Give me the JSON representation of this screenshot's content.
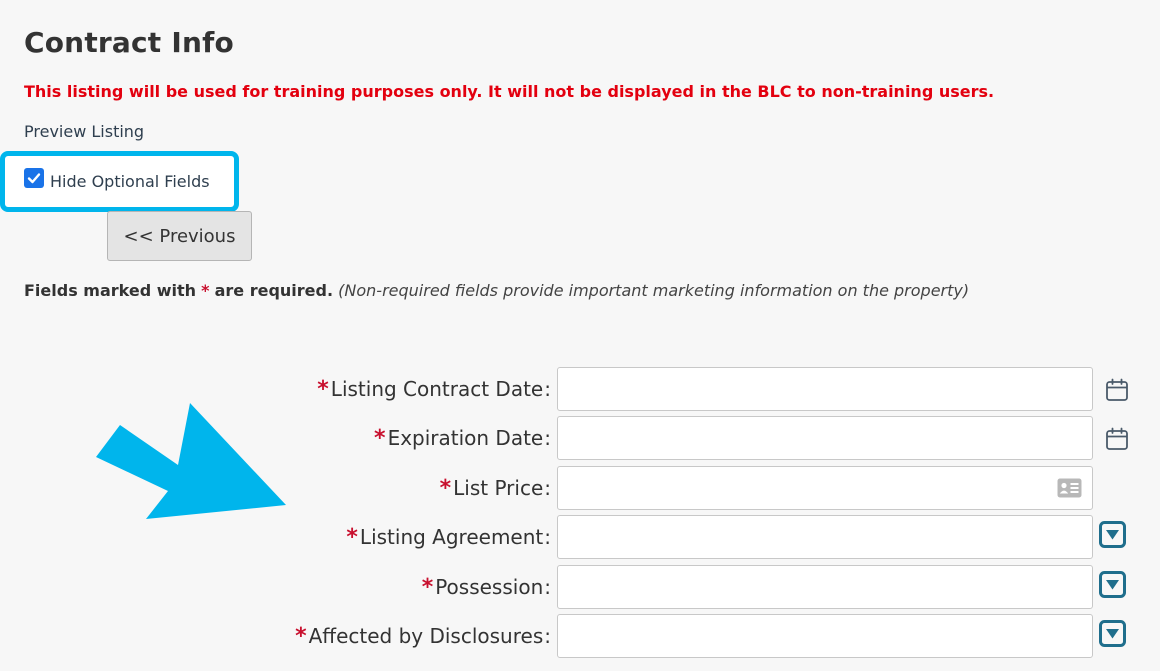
{
  "page": {
    "title": "Contract Info",
    "training_warning": "This listing will be used for training purposes only. It will not be displayed in the BLC to non-training users.",
    "preview_link": "Preview Listing"
  },
  "options": {
    "hide_optional_label": "Hide Optional Fields",
    "hide_optional_checked": true
  },
  "nav": {
    "previous_label": "<< Previous"
  },
  "required_note": {
    "prefix": "Fields marked with",
    "star": "*",
    "suffix": "are required.",
    "hint": "(Non-required fields provide important marketing information on the property)"
  },
  "form": {
    "fields": [
      {
        "label": "Listing Contract Date",
        "required": true,
        "value": "",
        "icon": "calendar-icon"
      },
      {
        "label": "Expiration Date",
        "required": true,
        "value": "",
        "icon": "calendar-icon"
      },
      {
        "label": "List Price",
        "required": true,
        "value": "",
        "icon": "contact-card-icon"
      },
      {
        "label": "Listing Agreement",
        "required": true,
        "value": "",
        "icon": "dropdown-arrow-icon"
      },
      {
        "label": "Possession",
        "required": true,
        "value": "",
        "icon": "dropdown-arrow-icon"
      },
      {
        "label": "Affected by Disclosures",
        "required": true,
        "value": "",
        "icon": "dropdown-arrow-icon"
      }
    ],
    "required_marker": "*",
    "colon": ":"
  },
  "annotation": {
    "arrow_color": "#00b5ec",
    "highlight_color": "#00b5ec"
  },
  "colors": {
    "warning": "#e3000f",
    "required_star": "#c8102e",
    "icon_teal": "#1f6e8c"
  }
}
